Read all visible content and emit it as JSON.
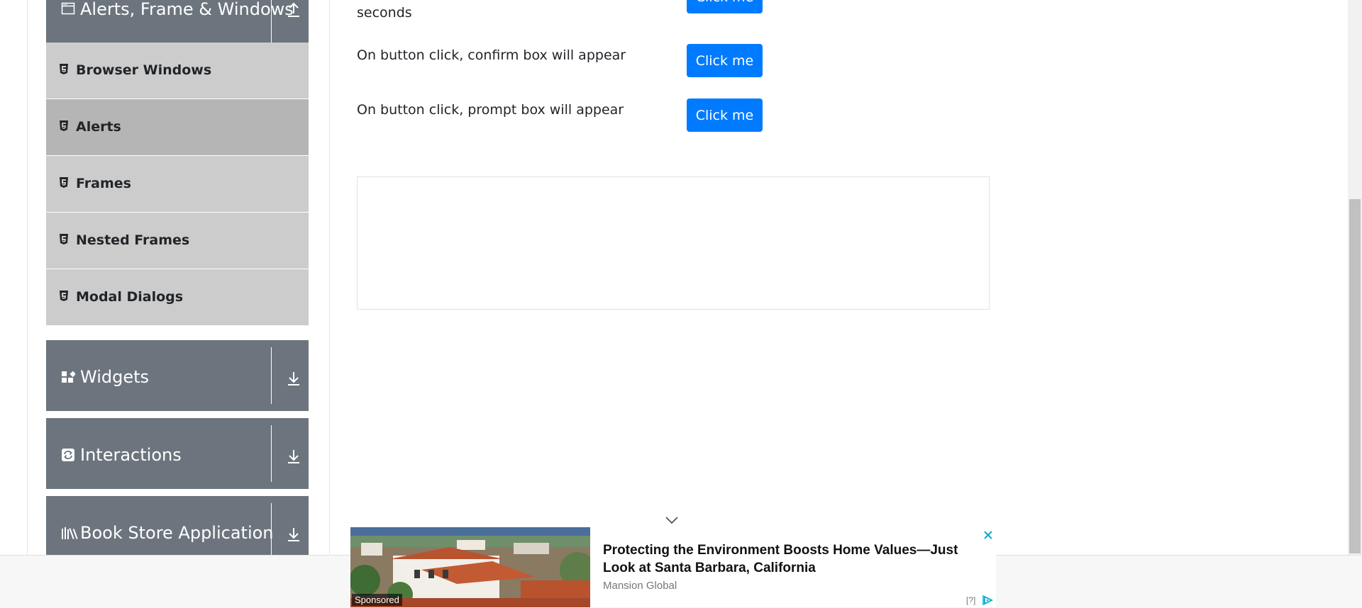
{
  "sidebar": {
    "alerts_group": {
      "label": "Alerts, Frame & Windows",
      "icon": "window-icon",
      "toggle_icon": "collapse-arrow-icon"
    },
    "items": [
      {
        "label": "Browser Windows",
        "icon": "html5-icon"
      },
      {
        "label": "Alerts",
        "icon": "html5-icon",
        "active": true
      },
      {
        "label": "Frames",
        "icon": "html5-icon"
      },
      {
        "label": "Nested Frames",
        "icon": "html5-icon"
      },
      {
        "label": "Modal Dialogs",
        "icon": "html5-icon"
      }
    ],
    "groups": [
      {
        "label": "Widgets",
        "icon": "widgets-icon",
        "toggle_icon": "expand-arrow-icon"
      },
      {
        "label": "Interactions",
        "icon": "interactions-icon",
        "toggle_icon": "expand-arrow-icon"
      },
      {
        "label": "Book Store Application",
        "icon": "book-store-icon",
        "toggle_icon": "expand-arrow-icon"
      }
    ]
  },
  "main": {
    "timer_row": {
      "text_tail": "seconds",
      "button_label": "Click me"
    },
    "confirm_row": {
      "text": "On button click, confirm box will appear",
      "button_label": "Click me"
    },
    "prompt_row": {
      "text": "On button click, prompt box will appear",
      "button_label": "Click me"
    }
  },
  "banner": {
    "sponsored_label": "Sponsored",
    "title": "Protecting the Environment Boosts Home Values—Just Look at Santa Barbara, California",
    "source": "Mansion Global",
    "adchoices_label": "[?]"
  },
  "colors": {
    "sidebar_header": "#6c757d",
    "menu_item": "#cccccc",
    "menu_item_active": "#b5b5b5",
    "primary_button": "#007bff",
    "adchoices": "#00aecd"
  }
}
